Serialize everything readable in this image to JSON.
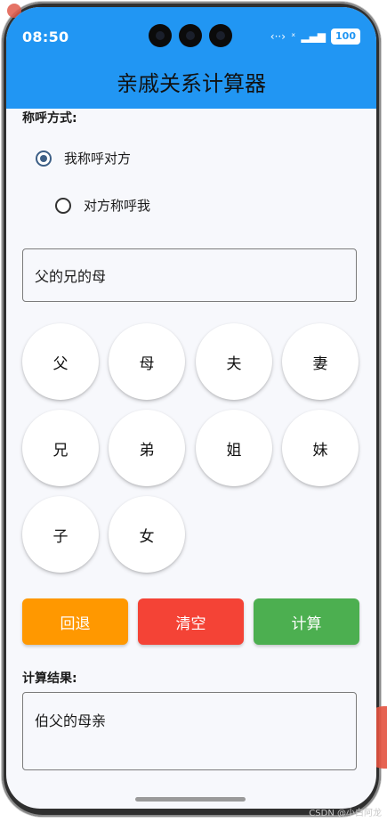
{
  "status_bar": {
    "time": "08:50",
    "icons": [
      "link-icon",
      "no-signal-icon",
      "signal-icon"
    ],
    "battery": "100"
  },
  "app_bar": {
    "title": "亲戚关系计算器"
  },
  "form": {
    "label_mode": "称呼方式:",
    "options": [
      {
        "label": "我称呼对方",
        "selected": true
      },
      {
        "label": "对方称呼我",
        "selected": false
      }
    ],
    "input_value": "父的兄的母"
  },
  "keypad": {
    "keys": [
      "父",
      "母",
      "夫",
      "妻",
      "兄",
      "弟",
      "姐",
      "妹",
      "子",
      "女"
    ]
  },
  "actions": {
    "back": {
      "label": "回退",
      "color": "#ff9800"
    },
    "clear": {
      "label": "清空",
      "color": "#f44336"
    },
    "calc": {
      "label": "计算",
      "color": "#4caf50"
    }
  },
  "result": {
    "label": "计算结果:",
    "value": "伯父的母亲"
  },
  "watermark": "CSDN @小白阿龙",
  "colors": {
    "primary": "#2196f3",
    "background": "#f7f8fc"
  }
}
